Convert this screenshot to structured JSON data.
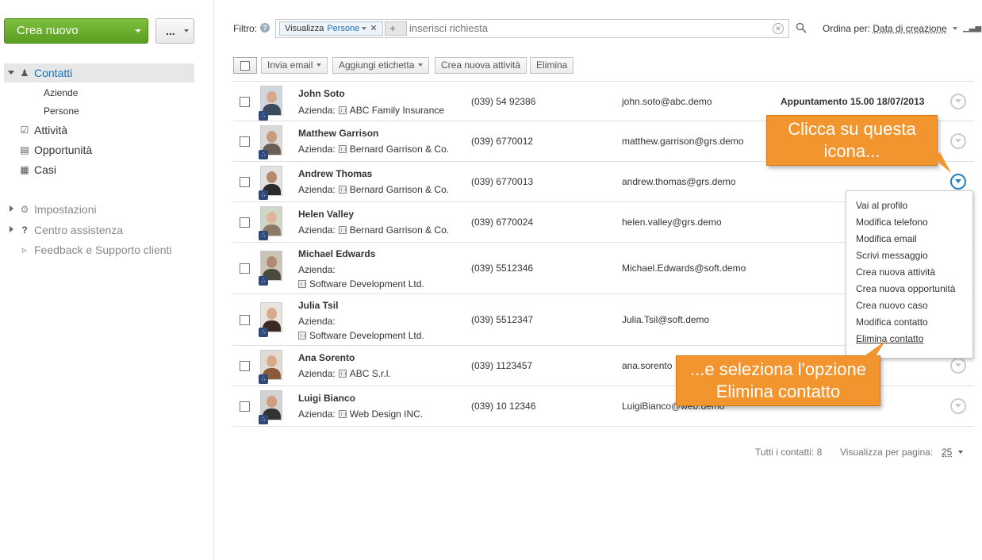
{
  "sidebar": {
    "create_label": "Crea nuovo",
    "more_label": "...",
    "nav": {
      "contacts": "Contatti",
      "companies": "Aziende",
      "people": "Persone",
      "activities": "Attività",
      "opportunities": "Opportunità",
      "cases": "Casi",
      "settings": "Impostazioni",
      "help_center": "Centro assistenza",
      "feedback": "Feedback e Supporto clienti"
    }
  },
  "filter": {
    "label": "Filtro:",
    "chip_key": "Visualizza",
    "chip_value": "Persone",
    "placeholder": "inserisci richiesta",
    "add_label": "+"
  },
  "sort": {
    "label": "Ordina per:",
    "value": "Data di creazione"
  },
  "actions": {
    "send_email": "Invia email",
    "add_tag": "Aggiungi etichetta",
    "new_activity": "Crea nuova attività",
    "delete": "Elimina"
  },
  "contacts": [
    {
      "name": "John Soto",
      "company_label": "Azienda:",
      "company": "ABC Family Insurance",
      "phone": "(039) 54 92386",
      "email": "john.soto@abc.demo",
      "note": "Appuntamento 15.00 18/07/2013"
    },
    {
      "name": "Matthew Garrison",
      "company_label": "Azienda:",
      "company": "Bernard Garrison & Co.",
      "phone": "(039) 6770012",
      "email": "matthew.garrison@grs.demo",
      "note": ""
    },
    {
      "name": "Andrew Thomas",
      "company_label": "Azienda:",
      "company": "Bernard Garrison & Co.",
      "phone": "(039) 6770013",
      "email": "andrew.thomas@grs.demo",
      "note": ""
    },
    {
      "name": "Helen Valley",
      "company_label": "Azienda:",
      "company": "Bernard Garrison & Co.",
      "phone": "(039) 6770024",
      "email": "helen.valley@grs.demo",
      "note": ""
    },
    {
      "name": "Michael Edwards",
      "company_label": "Azienda:",
      "company": "Software Development Ltd.",
      "phone": "(039) 5512346",
      "email": "Michael.Edwards@soft.demo",
      "note": ""
    },
    {
      "name": "Julia Tsil",
      "company_label": "Azienda:",
      "company": "Software Development Ltd.",
      "phone": "(039) 5512347",
      "email": "Julia.Tsil@soft.demo",
      "note": ""
    },
    {
      "name": "Ana Sorento",
      "company_label": "Azienda:",
      "company": "ABC S.r.l.",
      "phone": "(039) 1123457",
      "email": "ana.sorento",
      "note": ""
    },
    {
      "name": "Luigi Bianco",
      "company_label": "Azienda:",
      "company": "Web Design INC.",
      "phone": "(039) 10 12346",
      "email": "LuigiBianco@web.demo",
      "note": ""
    }
  ],
  "dropdown": [
    "Vai al profilo",
    "Modifica telefono",
    "Modifica email",
    "Scrivi messaggio",
    "Crea nuova attività",
    "Crea nuova opportunità",
    "Crea nuovo caso",
    "Modifica contatto",
    "Elimina contatto"
  ],
  "callouts": {
    "top_line1": "Clicca su questa",
    "top_line2": "icona...",
    "bottom_line1": "...e seleziona l'opzione",
    "bottom_line2": "Elimina contatto"
  },
  "footer": {
    "total": "Tutti i contatti: 8",
    "per_page_label": "Visualizza per pagina:",
    "per_page_value": "25"
  },
  "colors": {
    "create_button": "#6aaf2e",
    "accent_link": "#1d6fb4",
    "callout": "#f2952f"
  }
}
